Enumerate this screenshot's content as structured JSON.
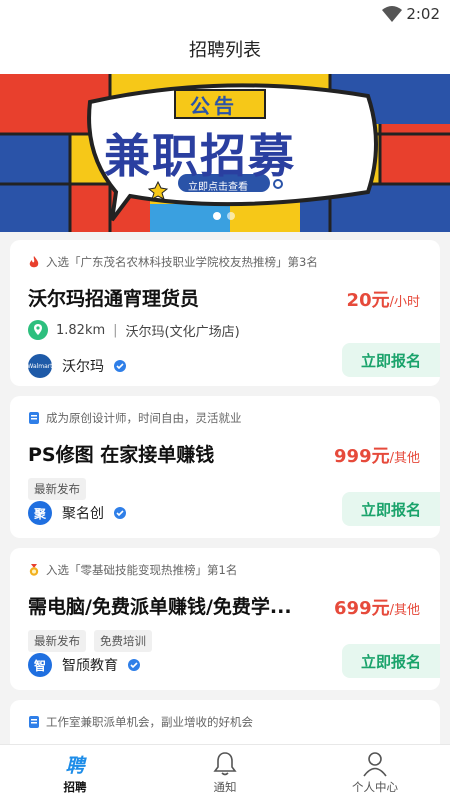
{
  "status": {
    "time": "2:02"
  },
  "header": {
    "title": "招聘列表"
  },
  "banner": {
    "top_text": "公告",
    "main_text": "兼职招募",
    "cta": "立即点击查看",
    "slides": 2,
    "active_slide": 0
  },
  "jobs": [
    {
      "tag": "入选「广东茂名农林科技职业学院校友热推榜」第3名",
      "title": "沃尔玛招通宵理货员",
      "pay": "20元",
      "unit": "/小时",
      "distance": "1.82km",
      "location": "沃尔玛(文化广场店)",
      "company": "沃尔玛",
      "logo_text": "Walmart",
      "logo_color": "#1e5aa8",
      "apply": "立即报名"
    },
    {
      "tag": "成为原创设计师，时间自由，灵活就业",
      "title": "PS修图 在家接单赚钱",
      "pay": "999元",
      "unit": "/其他",
      "badges": [
        "最新发布"
      ],
      "company": "聚名创",
      "logo_text": "聚",
      "logo_color": "#1f6fe0",
      "apply": "立即报名"
    },
    {
      "tag": "入选「零基础技能变现热推榜」第1名",
      "title": "需电脑/免费派单赚钱/免费学...",
      "pay": "699元",
      "unit": "/其他",
      "badges": [
        "最新发布",
        "免费培训"
      ],
      "company": "智颀教育",
      "logo_text": "智",
      "logo_color": "#1f6fe0",
      "apply": "立即报名"
    },
    {
      "tag": "工作室兼职派单机会，副业增收的好机会"
    }
  ],
  "tabs": [
    {
      "label": "招聘",
      "glyph": "聘",
      "active": true
    },
    {
      "label": "通知",
      "icon": "bell-icon"
    },
    {
      "label": "个人中心",
      "icon": "user-icon"
    }
  ],
  "colors": {
    "accent": "#1aa36b",
    "pay": "#e64a3b",
    "brand": "#1e8de8"
  }
}
